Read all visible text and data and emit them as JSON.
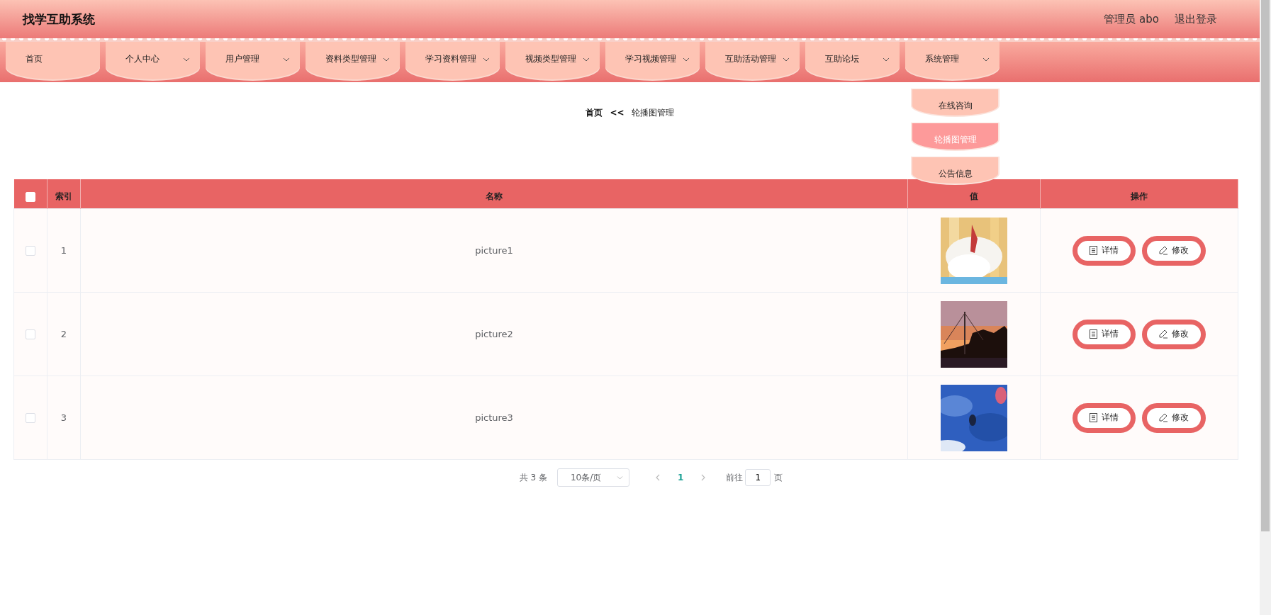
{
  "header": {
    "title": "找学互助系统",
    "user": "管理员 abo",
    "logout": "退出登录"
  },
  "nav": [
    {
      "label": "首页",
      "has_menu": false
    },
    {
      "label": "个人中心",
      "has_menu": true
    },
    {
      "label": "用户管理",
      "has_menu": true
    },
    {
      "label": "资料类型管理",
      "has_menu": true
    },
    {
      "label": "学习资料管理",
      "has_menu": true
    },
    {
      "label": "视频类型管理",
      "has_menu": true
    },
    {
      "label": "学习视频管理",
      "has_menu": true
    },
    {
      "label": "互助活动管理",
      "has_menu": true
    },
    {
      "label": "互助论坛",
      "has_menu": true
    },
    {
      "label": "系统管理",
      "has_menu": true,
      "children": [
        {
          "label": "在线咨询",
          "selected": false
        },
        {
          "label": "轮播图管理",
          "selected": true
        },
        {
          "label": "公告信息",
          "selected": false
        }
      ]
    }
  ],
  "breadcrumb": {
    "home": "首页",
    "separator": "<<",
    "current": "轮播图管理"
  },
  "table": {
    "select_all": {
      "checked": false
    },
    "columns": [
      "索引",
      "名称",
      "值",
      "操作"
    ],
    "rows": [
      {
        "checked": false,
        "index": "1",
        "name": "picture1",
        "value": {
          "kind": "picture"
        },
        "actions": [
          "详情",
          "修改"
        ]
      },
      {
        "checked": false,
        "index": "2",
        "name": "picture2",
        "value": {
          "kind": "picture"
        },
        "actions": [
          "详情",
          "修改"
        ]
      },
      {
        "checked": false,
        "index": "3",
        "name": "picture3",
        "value": {
          "kind": "picture"
        },
        "actions": [
          "详情",
          "修改"
        ]
      }
    ]
  },
  "pagination": {
    "total": "共 3 条",
    "page_size": "10条/页",
    "pages": [
      {
        "label": "1",
        "selected": true
      }
    ],
    "goto_label": "前往",
    "goto_value": "1",
    "page_unit": "页"
  }
}
